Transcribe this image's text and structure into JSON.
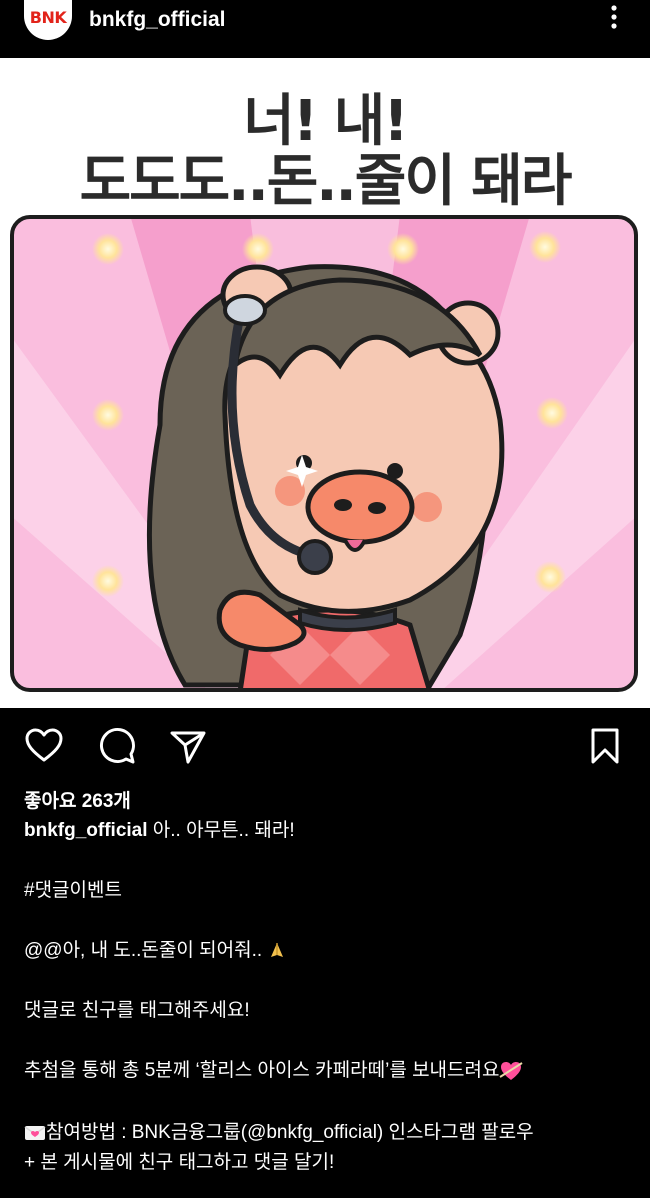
{
  "header": {
    "avatar_text": "BNK",
    "username": "bnkfg_official"
  },
  "post_image": {
    "headline_line1": "너! 내!",
    "headline_line2": "도도도..돈..줄이 돼라"
  },
  "actions": {
    "like_icon": "heart-icon",
    "comment_icon": "comment-icon",
    "share_icon": "send-icon",
    "save_icon": "bookmark-icon"
  },
  "likes_text": "좋아요 263개",
  "caption": {
    "username": "bnkfg_official",
    "line1": " 아.. 아무튼.. 돼라!",
    "hashtag": "#댓글이벤트",
    "line3": "@@아, 내 도..돈줄이 되어줘.. ",
    "line4": "댓글로 친구를 태그해주세요!",
    "line5": "추첨을 통해 총 5분께 ‘할리스 아이스 카페라떼’를 보내드려요",
    "line6": "참여방법 : BNK금융그룹(@bnkfg_official) 인스타그램 팔로우",
    "line7": "+ 본 게시물에 친구 태그하고 댓글 달기!"
  },
  "colors": {
    "background": "#000000",
    "brand_red": "#e2231a",
    "stage_pink": "#f7a8cf",
    "character_skin": "#f6c9b4"
  }
}
